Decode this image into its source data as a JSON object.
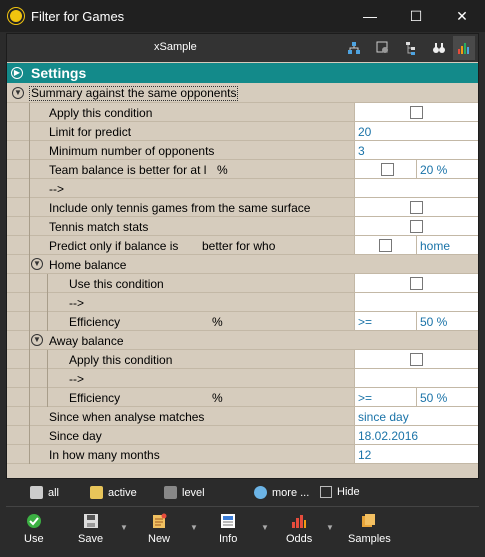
{
  "window": {
    "title": "Filter for Games",
    "minimize": "—",
    "maximize": "☐",
    "close": "✕"
  },
  "toolbar": {
    "sample": "xSample"
  },
  "settings": {
    "header": "Settings"
  },
  "summary": {
    "label": "Summary against the same opponents"
  },
  "rows": {
    "apply": "Apply this condition",
    "limit_label": "Limit for predict",
    "limit_value": "20",
    "minopp_label": "Minimum number of opponents",
    "minopp_value": "3",
    "team_label": "Team balance is better for at l",
    "team_unit": "%",
    "team_value": "20 %",
    "arrow1": "-->",
    "surface": "Include only tennis games from the same surface",
    "stats": "Tennis match stats",
    "predict_label": "Predict only if balance is",
    "predict_mid": "better for who",
    "predict_value": "home"
  },
  "home": {
    "header": "Home balance",
    "use": "Use this condition",
    "arrow": "-->",
    "eff_label": "Efficiency",
    "eff_unit": "%",
    "eff_op": ">=",
    "eff_value": "50 %"
  },
  "away": {
    "header": "Away balance",
    "apply": "Apply this condition",
    "arrow": "-->",
    "eff_label": "Efficiency",
    "eff_unit": "%",
    "eff_op": ">=",
    "eff_value": "50 %"
  },
  "since": {
    "when_label": "Since when analyse matches",
    "when_value": "since day",
    "day_label": "Since day",
    "day_value": "18.02.2016",
    "months_label": "In how many months",
    "months_value": "12"
  },
  "filterbar": {
    "all": "all",
    "active": "active",
    "level": "level",
    "more": "more ...",
    "hide": "Hide"
  },
  "actions": {
    "use": "Use",
    "save": "Save",
    "new": "New",
    "info": "Info",
    "odds": "Odds",
    "samples": "Samples"
  }
}
